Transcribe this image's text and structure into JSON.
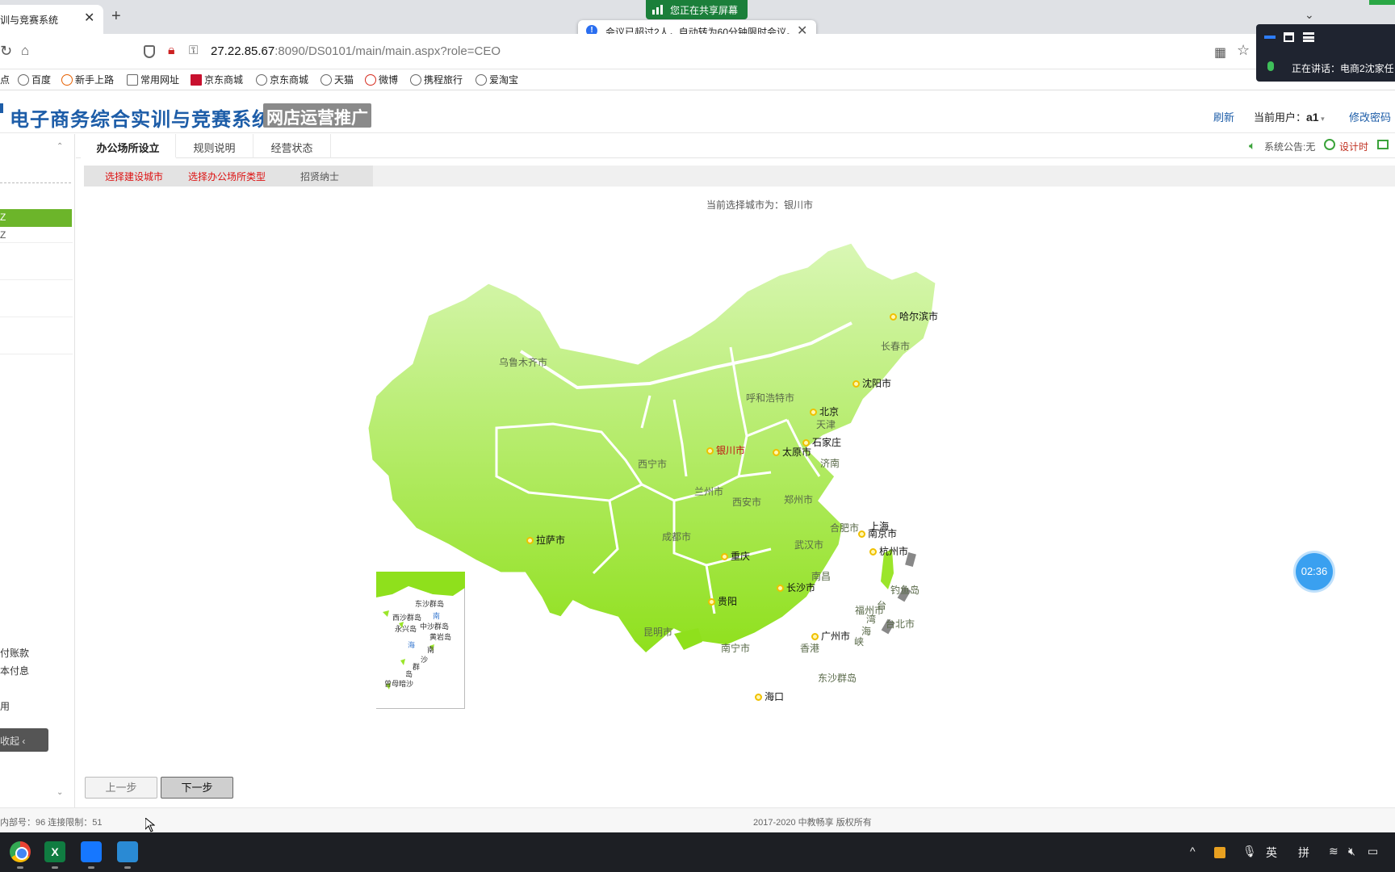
{
  "browser": {
    "tab_title": "训与竞赛系统",
    "tab_close": "✕",
    "new_tab": "+",
    "url_host": "27.22.85.67",
    "url_rest": ":8090/DS0101/main/main.aspx?role=CEO",
    "bookmarks": [
      "点",
      "百度",
      "新手上路",
      "常用网址",
      "京东商城",
      "京东商城",
      "天猫",
      "微博",
      "携程旅行",
      "爱淘宝"
    ]
  },
  "meeting": {
    "sharing_label": "您正在共享屏幕",
    "notice": "会议已超过2人，自动转为60分钟限时会议。",
    "speaking": "正在讲话：电商2沈家任"
  },
  "header": {
    "title": "电子商务综合实训与竞赛系统",
    "subtitle": "网店运营推广",
    "refresh": "刷新",
    "current_user_label": "当前用户：",
    "current_user": "a1",
    "change_password": "修改密码"
  },
  "sidebar": {
    "item_selected": "Z",
    "item_2": "Z",
    "text_1": "付账款",
    "text_2": "本付息",
    "text_3": "用",
    "collapse_label": "收起"
  },
  "tabs": [
    "办公场所设立",
    "规则说明",
    "经营状态"
  ],
  "status": {
    "announcement": "系统公告:无",
    "design_time": "设计时"
  },
  "steps": [
    "选择建设城市",
    "选择办公场所类型",
    "招贤纳士"
  ],
  "current_city": "当前选择城市为：银川市",
  "map_cities": {
    "harbin": "哈尔滨市",
    "changchun": "长春市",
    "shenyang": "沈阳市",
    "urumqi": "乌鲁木齐市",
    "hohhot": "呼和浩特市",
    "beijing": "北京",
    "tianjin": "天津",
    "shijiazhuang": "石家庄",
    "yinchuan": "银川市",
    "taiyuan": "太原市",
    "jinan": "济南",
    "xining": "西宁市",
    "lanzhou": "兰州市",
    "xian": "西安市",
    "zhengzhou": "郑州市",
    "hefei": "合肥市",
    "shanghai": "上海",
    "nanjing": "南京市",
    "hangzhou": "杭州市",
    "lhasa": "拉萨市",
    "chengdu": "成都市",
    "chongqing": "重庆",
    "wuhan": "武汉市",
    "nanchang": "南昌",
    "changsha": "长沙市",
    "diaoyu": "钓鱼岛",
    "fuzhou": "福州市",
    "taipei": "台北市",
    "taiwan_strait_1": "台",
    "taiwan_strait_2": "湾",
    "taiwan_strait_3": "海",
    "taiwan_strait_4": "峡",
    "guiyang": "贵阳",
    "kunming": "昆明市",
    "nanning": "南宁市",
    "guangzhou": "广州市",
    "hongkong": "香港",
    "dongsha": "东沙群岛",
    "haikou": "海口"
  },
  "inset": {
    "dongsha": "东沙群岛",
    "xisha": "西沙群岛",
    "yongxing": "永兴岛",
    "zhongsha": "中沙群岛",
    "nan": "南",
    "huangyan": "黄岩岛",
    "hai": "海",
    "nan2": "南",
    "qun": "群",
    "sha": "沙",
    "dao": "岛",
    "zengmu": "曾母暗沙"
  },
  "timer": "02:36",
  "buttons": {
    "prev": "上一步",
    "next": "下一步"
  },
  "footer": {
    "left": "内部号：96 连接限制：51",
    "copyright": "2017-2020 中教畅享 版权所有"
  },
  "taskbar": {
    "tray_ime1": "英",
    "tray_ime2": "拼",
    "tray_up": "^"
  },
  "colors": {
    "brand_blue": "#1d5da8",
    "accent_green": "#6cb52a",
    "step_red": "#dd1111",
    "selected_city": "#c01010"
  }
}
